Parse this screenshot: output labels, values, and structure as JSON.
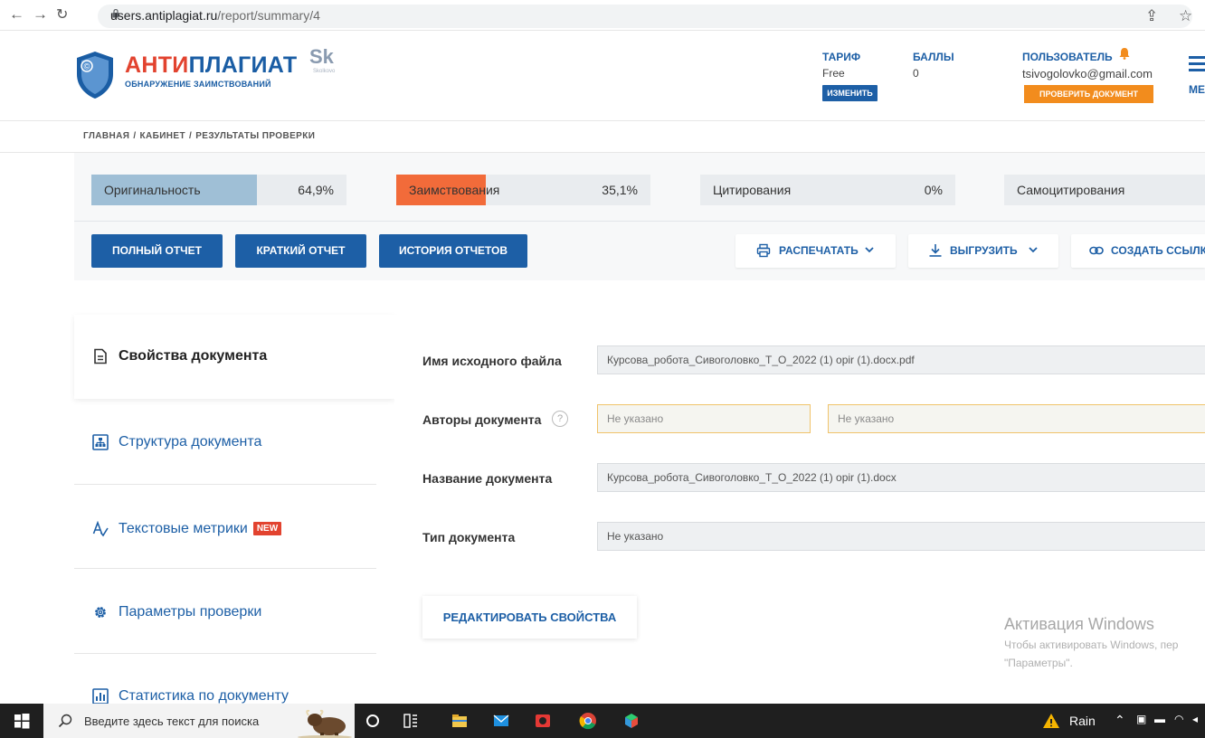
{
  "browser": {
    "url_host": "users.antiplagiat.ru",
    "url_path": "/report/summary/4"
  },
  "header": {
    "logo_red": "АНТИ",
    "logo_blue": "ПЛАГИАТ",
    "logo_sub": "ОБНАРУЖЕНИЕ ЗАИМСТВОВАНИЙ",
    "sk_logo": "Sk",
    "sk_sub": "Skolkovo",
    "tariff_label": "ТАРИФ",
    "tariff_value": "Free",
    "change_button": "ИЗМЕНИТЬ",
    "points_label": "БАЛЛЫ",
    "points_value": "0",
    "user_label": "ПОЛЬЗОВАТЕЛЬ",
    "user_email": "tsivogolovko@gmail.com",
    "check_button": "ПРОВЕРИТЬ ДОКУМЕНТ",
    "menu_label": "МЕ"
  },
  "breadcrumb": {
    "home": "ГЛАВНАЯ",
    "cabinet": "КАБИНЕТ",
    "results": "РЕЗУЛЬТАТЫ ПРОВЕРКИ",
    "separator": "/"
  },
  "metrics": [
    {
      "name": "Оригинальность",
      "value": "64,9%",
      "share": 0.649,
      "color": "#9fbfd6"
    },
    {
      "name": "Заимствования",
      "value": "35,1%",
      "share": 0.351,
      "color": "#f26b3a"
    },
    {
      "name": "Цитирования",
      "value": "0%",
      "share": 0,
      "color": "#9fbfd6"
    },
    {
      "name": "Самоцитирования",
      "value": "",
      "share": 0,
      "color": "#9fbfd6"
    }
  ],
  "report_buttons": {
    "full": "ПОЛНЫЙ ОТЧЕТ",
    "brief": "КРАТКИЙ ОТЧЕТ",
    "history": "ИСТОРИЯ ОТЧЕТОВ",
    "print": "РАСПЕЧАТАТЬ",
    "export": "ВЫГРУЗИТЬ",
    "link": "СОЗДАТЬ ССЫЛК"
  },
  "sidebar": {
    "items": [
      {
        "label": "Свойства документа",
        "icon": "document-icon",
        "active": true
      },
      {
        "label": "Структура документа",
        "icon": "structure-icon",
        "active": false
      },
      {
        "label": "Текстовые метрики",
        "icon": "text-metrics-icon",
        "badge": "NEW",
        "active": false
      },
      {
        "label": "Параметры проверки",
        "icon": "gear-icon",
        "active": false
      },
      {
        "label": "Статистика по документу",
        "icon": "bar-chart-icon",
        "active": false
      }
    ]
  },
  "form": {
    "file_name_label": "Имя исходного файла",
    "file_name_value": "Курсова_робота_Сивоголовко_Т_О_2022 (1) opir (1).docx.pdf",
    "authors_label": "Авторы документа",
    "authors_placeholder_1": "Не указано",
    "authors_placeholder_2": "Не указано",
    "title_label": "Название документа",
    "title_value": "Курсова_робота_Сивоголовко_Т_О_2022 (1) opir (1).docx",
    "type_label": "Тип документа",
    "type_value": "Не указано",
    "edit_button": "РЕДАКТИРОВАТЬ СВОЙСТВА",
    "help": "?"
  },
  "windows_activation": {
    "title": "Активация Windows",
    "line1": "Чтобы активировать Windows, пер",
    "line2": "\"Параметры\"."
  },
  "taskbar": {
    "search_placeholder": "Введите здесь текст для поиска",
    "weather": "Rain"
  }
}
